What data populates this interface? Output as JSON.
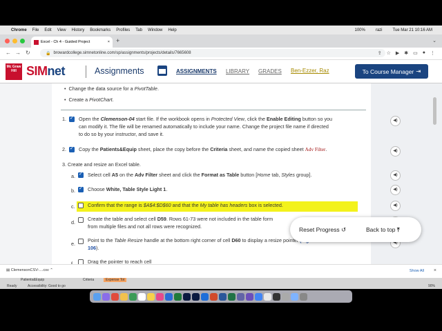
{
  "menubar": {
    "app": "Chrome",
    "items": [
      "File",
      "Edit",
      "View",
      "History",
      "Bookmarks",
      "Profiles",
      "Tab",
      "Window",
      "Help"
    ],
    "battery": "100%",
    "user": "razi",
    "datetime": "Tue Mar 21  10:16 AM"
  },
  "browser": {
    "tab_title": "Excel - Ch 4 - Guided Project",
    "url": "browardcollege.simnetonline.com/sp/assignments/projects/details/7665608"
  },
  "header": {
    "brand_logo": "Mc Graw Hill",
    "brand_sim": "SIM",
    "brand_net": "net",
    "page_title": "Assignments",
    "nav": [
      "ASSIGNMENTS",
      "LIBRARY",
      "GRADES"
    ],
    "user_name": "Ben-Ezzer, Raz",
    "course_manager": "To Course Manager"
  },
  "content": {
    "bullets": [
      "Change the data source for a PivotTable.",
      "Create a PivotChart."
    ],
    "steps": [
      {
        "num": "1.",
        "text_a": "Open the ",
        "file": "Clemenson-04",
        "text_b": " start file. If the workbook opens in ",
        "pv": "Protected View",
        "text_c": ", click the ",
        "enable": "Enable Editing",
        "text_d": " button so you",
        "line2": "can modify it. The file will be renamed automatically to include your name. Change the project file name if directed",
        "line3": "to do so by your instructor, and save it."
      },
      {
        "num": "2.",
        "text_a": "Copy the ",
        "sheet": "Patients&Equip",
        "text_b": " sheet, place the copy before the ",
        "criteria": "Criteria",
        "text_c": " sheet, and name the copied sheet ",
        "newname": "Adv Filter",
        "text_d": "."
      },
      {
        "num": "3.",
        "text": "Create and resize an Excel table."
      }
    ],
    "substeps": {
      "a": {
        "label": "a.",
        "t1": "Select cell ",
        "cell": "A5",
        "t2": " on the ",
        "sheet": "Adv Filter",
        "t3": " sheet and click the ",
        "btn": "Format as Table",
        "t4": " button [",
        "tab": "Home",
        "t5": " tab, ",
        "grp": "Styles",
        "t6": " group]."
      },
      "b": {
        "label": "b.",
        "t1": "Choose ",
        "style": "White, Table Style Light 1",
        "t2": "."
      },
      "c": {
        "label": "c.",
        "t1": "Confirm that the range is ",
        "range": "$A$4:$D$60",
        "t2": " and that the ",
        "hdr": "My table has headers",
        "t3": " box is selected."
      },
      "d": {
        "label": "d.",
        "t1": "Create the table and select cell ",
        "cell": "D59",
        "t2": ". Rows 61-73 were not included in the table form",
        "line2": "from multiple files and not all rows were recognized."
      },
      "e": {
        "label": "e.",
        "t1": "Point to the ",
        "handle": "Table Resize",
        "t2": " handle at the bottom right corner of cell ",
        "cell": "D60",
        "t3": " to display a resize pointer ",
        "fig": "(Figure 4-",
        "line2_fig": "106",
        "line2_t": ")."
      },
      "f": {
        "label": "f.",
        "t1": "Drag the pointer to reach cell"
      }
    },
    "float": {
      "reset": "Reset Progress",
      "back": "Back to top"
    }
  },
  "downloads": {
    "file": "ClemensonCSV-....csv",
    "show_all": "Show All"
  },
  "excel_strip": {
    "tab1": "Patients&Equip",
    "tab2": "Criteria",
    "tab3": "Expense Tot",
    "status": "Ready",
    "accessibility": "Accessibility: Good to go",
    "zoom": "90%"
  }
}
